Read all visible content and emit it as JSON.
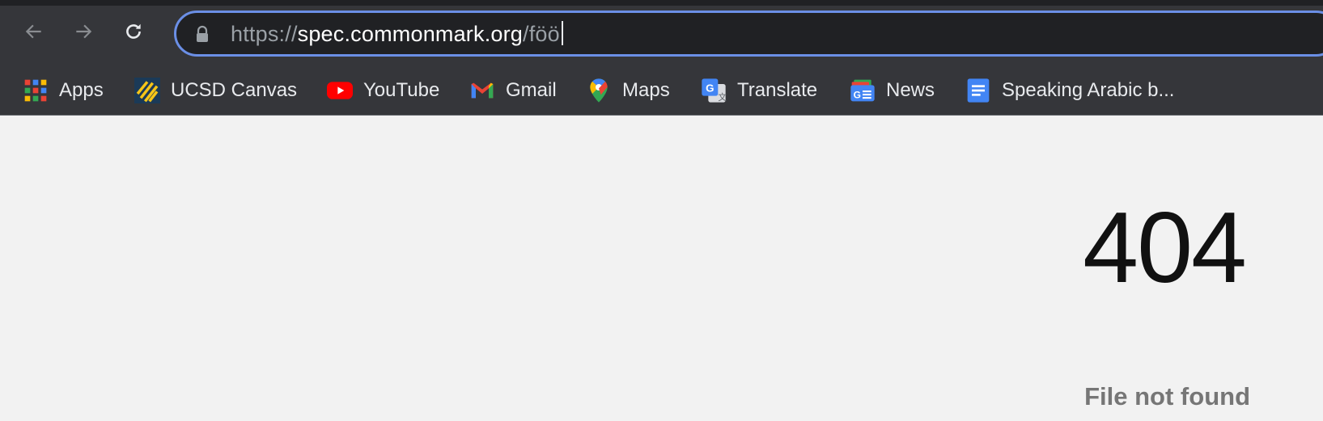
{
  "browser": {
    "url_scheme": "https://",
    "url_host": "spec.commonmark.org",
    "url_path": "/föö",
    "bookmarks": [
      {
        "label": "Apps",
        "icon": "apps-grid-icon"
      },
      {
        "label": "UCSD Canvas",
        "icon": "canvas-icon"
      },
      {
        "label": "YouTube",
        "icon": "youtube-icon"
      },
      {
        "label": "Gmail",
        "icon": "gmail-icon"
      },
      {
        "label": "Maps",
        "icon": "maps-pin-icon"
      },
      {
        "label": "Translate",
        "icon": "translate-icon"
      },
      {
        "label": "News",
        "icon": "news-icon"
      },
      {
        "label": "Speaking Arabic b...",
        "icon": "docs-icon"
      }
    ]
  },
  "page": {
    "code": "404",
    "message": "File not found"
  },
  "colors": {
    "omnibox_focus_border": "#6b8fe6",
    "toolbar_bg": "#35363a",
    "page_bg": "#f2f2f2"
  }
}
